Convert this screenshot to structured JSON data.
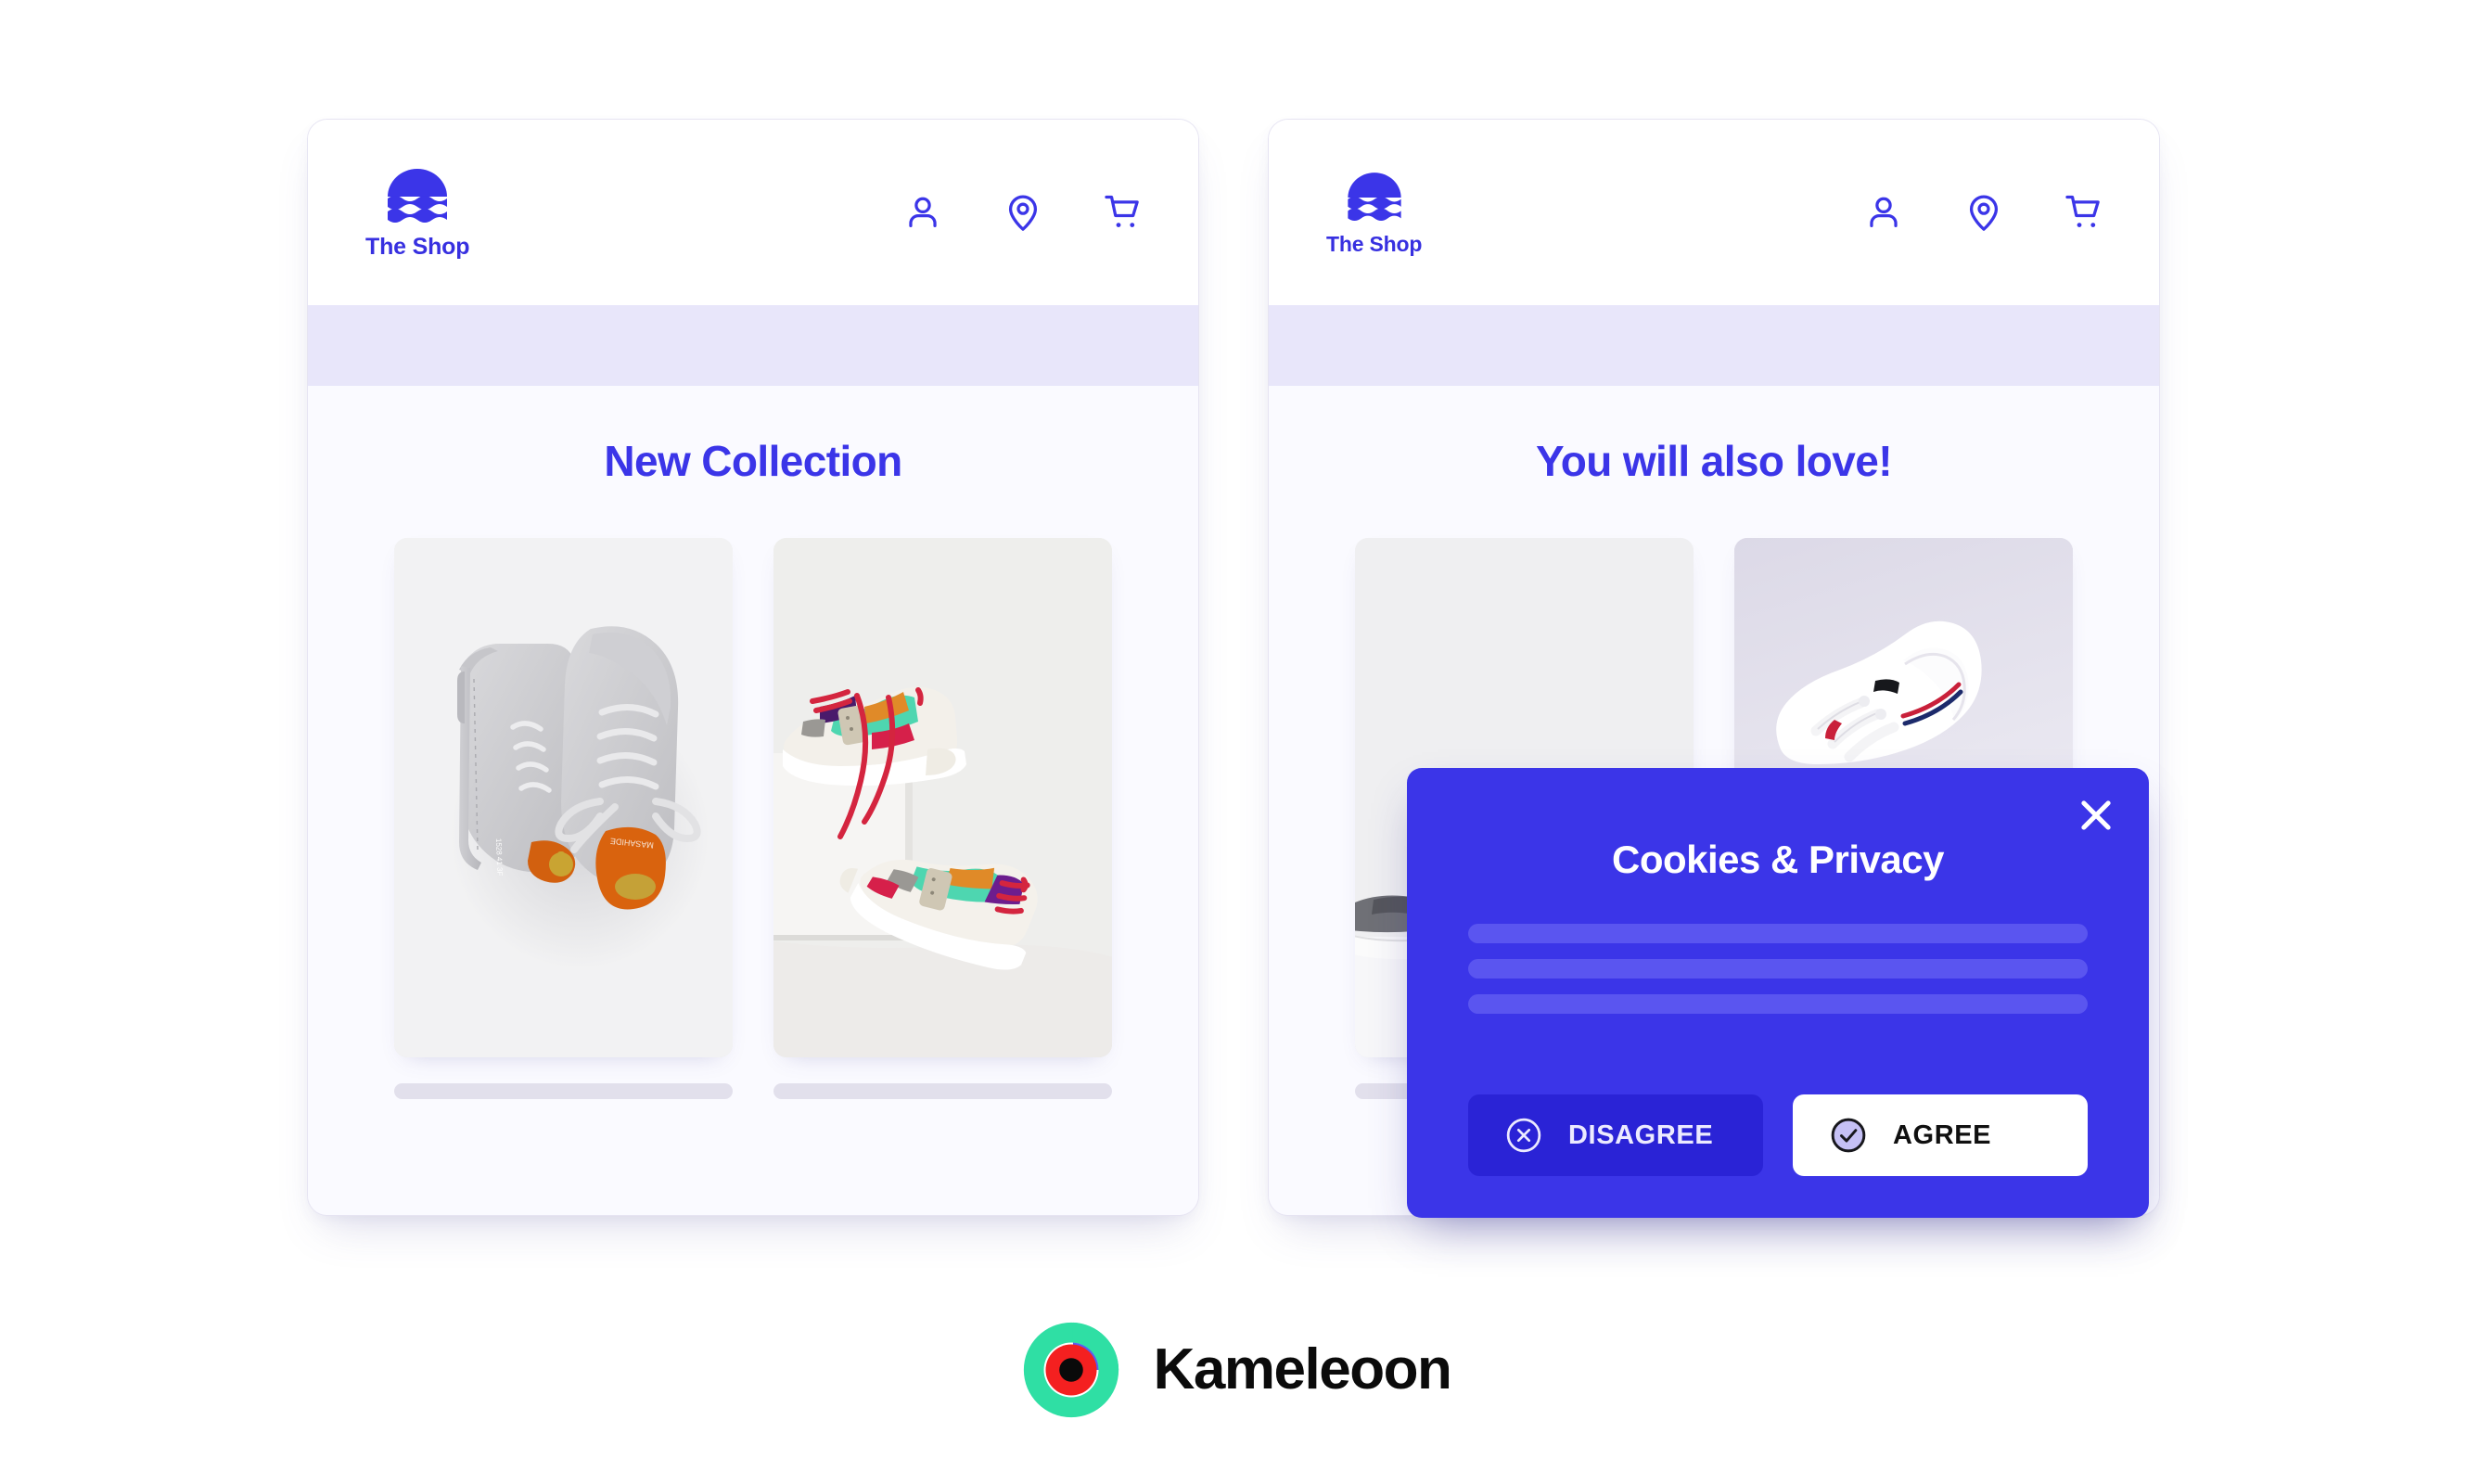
{
  "page": {
    "background_color": "#ffffff",
    "accent_color": "#3b35e8",
    "band_color": "#e8e6fa"
  },
  "panels": [
    {
      "id": "left",
      "header": {
        "logo_text": "The Shop",
        "logo_icon": "sunset-waves-icon",
        "nav_icons": [
          {
            "name": "user-icon",
            "label": "Account"
          },
          {
            "name": "location-pin-icon",
            "label": "Store locator"
          },
          {
            "name": "shopping-cart-icon",
            "label": "Cart"
          }
        ]
      },
      "section_title": "New Collection",
      "products": [
        {
          "name": "grey-leather-sneakers",
          "alt": "Grey leather sneakers with orange insoles, top view"
        },
        {
          "name": "colorblock-sneakers",
          "alt": "Colour-block sneakers with red laces on a white pedestal"
        }
      ]
    },
    {
      "id": "right",
      "header": {
        "logo_text": "The Shop",
        "logo_icon": "sunset-waves-icon",
        "nav_icons": [
          {
            "name": "user-icon",
            "label": "Account"
          },
          {
            "name": "location-pin-icon",
            "label": "Store locator"
          },
          {
            "name": "shopping-cart-icon",
            "label": "Cart"
          }
        ]
      },
      "section_title": "You will also love!",
      "products": [
        {
          "name": "dark-grey-sneaker",
          "alt": "Dark grey sneaker on white background"
        },
        {
          "name": "white-leather-sneaker",
          "alt": "White leather sneaker with red and navy stripe"
        }
      ]
    }
  ],
  "cookie_modal": {
    "title": "Cookies & Privacy",
    "close_icon": "close-x-icon",
    "body_placeholder_lines": 3,
    "buttons": {
      "disagree": {
        "label": "DISAGREE",
        "icon": "circle-x-icon",
        "bg": "#2a23d6",
        "text_color": "#eceaff"
      },
      "agree": {
        "label": "AGREE",
        "icon": "circle-check-icon",
        "bg": "#ffffff",
        "text_color": "#101010"
      }
    },
    "bg": "#3b35e8"
  },
  "brand": {
    "name": "Kameleoon",
    "mark": "kameleoon-logo-icon",
    "colors": {
      "ring": "#2fdfa4",
      "wedge": "#5b5bf0",
      "inner": "#f42020",
      "core": "#0a0a0a"
    }
  }
}
